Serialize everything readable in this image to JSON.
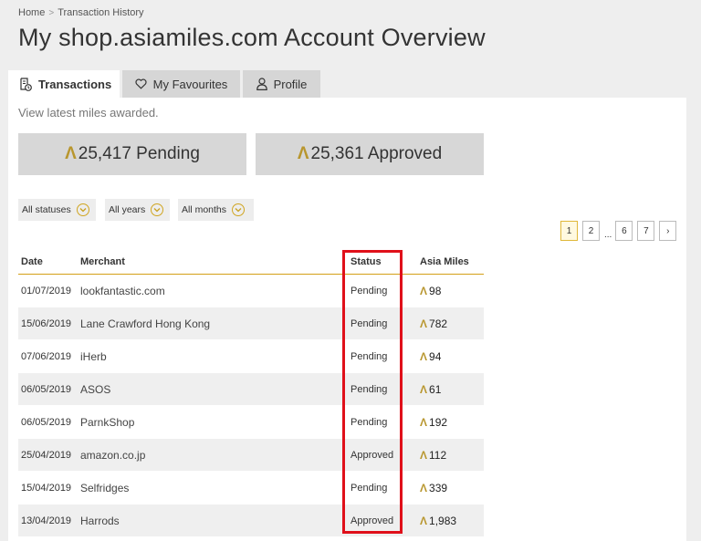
{
  "breadcrumb": {
    "home": "Home",
    "separator": ">",
    "current": "Transaction History"
  },
  "page_title": "My shop.asiamiles.com Account Overview",
  "tabs": [
    {
      "label": "Transactions",
      "icon": "receipt-clock-icon",
      "active": true
    },
    {
      "label": "My Favourites",
      "icon": "heart-icon",
      "active": false
    },
    {
      "label": "Profile",
      "icon": "person-icon",
      "active": false
    }
  ],
  "subtitle": "View latest miles awarded.",
  "miles_symbol": "Λ",
  "summary": {
    "pending": "25,417 Pending",
    "approved": "25,361 Approved"
  },
  "filters": {
    "statuses": "All statuses",
    "years": "All years",
    "months": "All months"
  },
  "pagination": {
    "pages": [
      "1",
      "2",
      "6",
      "7"
    ],
    "ellipsis": "...",
    "next": "›",
    "current": "1"
  },
  "table": {
    "headers": {
      "date": "Date",
      "merchant": "Merchant",
      "status": "Status",
      "miles": "Asia Miles"
    },
    "rows": [
      {
        "date": "01/07/2019",
        "merchant": "lookfantastic.com",
        "status": "Pending",
        "miles": "98"
      },
      {
        "date": "15/06/2019",
        "merchant": "Lane Crawford Hong Kong",
        "status": "Pending",
        "miles": "782"
      },
      {
        "date": "07/06/2019",
        "merchant": "iHerb",
        "status": "Pending",
        "miles": "94"
      },
      {
        "date": "06/05/2019",
        "merchant": "ASOS",
        "status": "Pending",
        "miles": "61"
      },
      {
        "date": "06/05/2019",
        "merchant": "ParnkShop",
        "status": "Pending",
        "miles": "192"
      },
      {
        "date": "25/04/2019",
        "merchant": "amazon.co.jp",
        "status": "Approved",
        "miles": "112"
      },
      {
        "date": "15/04/2019",
        "merchant": "Selfridges",
        "status": "Pending",
        "miles": "339"
      },
      {
        "date": "13/04/2019",
        "merchant": "Harrods",
        "status": "Approved",
        "miles": "1,983"
      }
    ]
  },
  "colors": {
    "accent": "#d4a017",
    "highlight": "#e0101a",
    "miles_symbol": "#b8962e"
  }
}
